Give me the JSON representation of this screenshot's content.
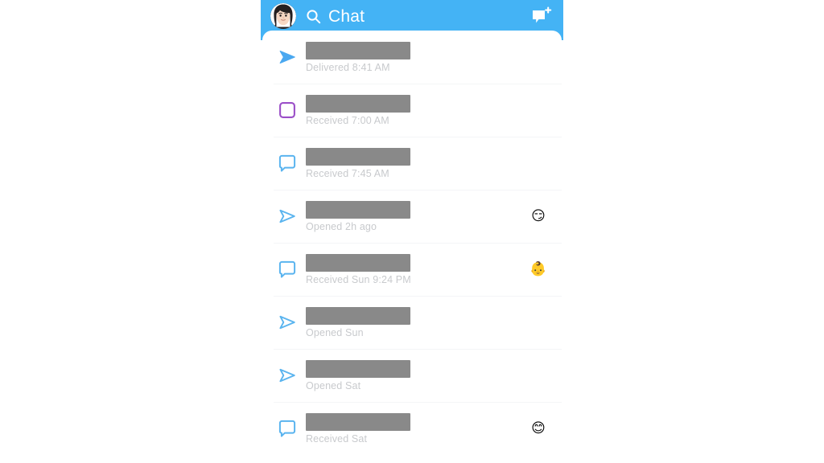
{
  "app": {
    "platform": "snapchat",
    "screen_name": "Chat",
    "accent_color": "#44b3f5",
    "header_background": "#44b3f5",
    "sheet_background": "#ffffff",
    "page_background": "#ffffff",
    "redaction_color": "#898989",
    "substatus_color": "#c8cacd",
    "unopened_snap_color": "#9b4fc8",
    "opened_color": "#5ab4ef"
  },
  "header": {
    "avatar_label": "profile-bitmoji",
    "search_icon": "search-icon",
    "title": "Chat",
    "new_chat_icon": "new-chat-icon",
    "new_chat_badge": "+"
  },
  "chat_list": {
    "rows": [
      {
        "icon": "snap-sent-filled-arrow-icon",
        "icon_type": "arrow-filled",
        "icon_color": "#4aa8f0",
        "name_redacted": true,
        "status": "Delivered 8:41 AM",
        "emoji": "",
        "emoji_name": ""
      },
      {
        "icon": "snap-received-unopened-square-icon",
        "icon_type": "square-outline",
        "icon_color": "#9b4fc8",
        "name_redacted": true,
        "status": "Received 7:00 AM",
        "emoji": "",
        "emoji_name": ""
      },
      {
        "icon": "chat-received-bubble-icon",
        "icon_type": "bubble-outline",
        "icon_color": "#5ab4ef",
        "name_redacted": true,
        "status": "Received 7:45 AM",
        "emoji": "",
        "emoji_name": ""
      },
      {
        "icon": "snap-opened-arrow-outline-icon",
        "icon_type": "arrow-outline",
        "icon_color": "#5ab4ef",
        "name_redacted": true,
        "status": "Opened 2h ago",
        "emoji": "😏",
        "emoji_name": "smirking-face-emoji"
      },
      {
        "icon": "chat-received-bubble-icon",
        "icon_type": "bubble-outline",
        "icon_color": "#5ab4ef",
        "name_redacted": true,
        "status": "Received Sun 9:24 PM",
        "emoji": "👶",
        "emoji_name": "baby-emoji"
      },
      {
        "icon": "snap-opened-arrow-outline-icon",
        "icon_type": "arrow-outline",
        "icon_color": "#5ab4ef",
        "name_redacted": true,
        "status": "Opened Sun",
        "emoji": "",
        "emoji_name": ""
      },
      {
        "icon": "snap-opened-arrow-outline-icon",
        "icon_type": "arrow-outline",
        "icon_color": "#5ab4ef",
        "name_redacted": true,
        "status": "Opened Sat",
        "emoji": "",
        "emoji_name": ""
      },
      {
        "icon": "chat-received-bubble-icon",
        "icon_type": "bubble-outline",
        "icon_color": "#5ab4ef",
        "name_redacted": true,
        "status": "Received Sat",
        "emoji": "😊",
        "emoji_name": "smiling-face-with-smiling-eyes-emoji"
      }
    ]
  }
}
